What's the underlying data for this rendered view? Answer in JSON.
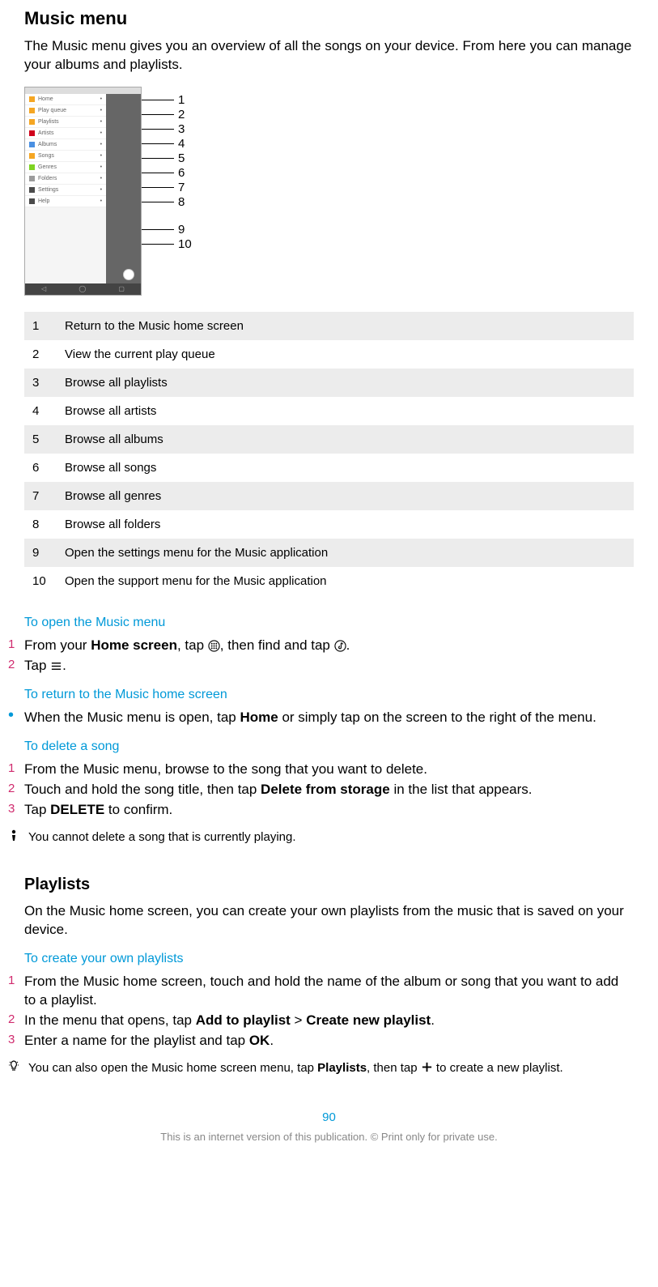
{
  "h1": "Music menu",
  "intro": "The Music menu gives you an overview of all the songs on your device. From here you can manage your albums and playlists.",
  "phone_menu": [
    {
      "label": "Home",
      "color": "#f5a623"
    },
    {
      "label": "Play queue",
      "color": "#f5a623"
    },
    {
      "label": "Playlists",
      "color": "#f5a623"
    },
    {
      "label": "Artists",
      "color": "#d0021b"
    },
    {
      "label": "Albums",
      "color": "#4a90e2"
    },
    {
      "label": "Songs",
      "color": "#f5a623"
    },
    {
      "label": "Genres",
      "color": "#7ed321"
    },
    {
      "label": "Folders",
      "color": "#9b9b9b"
    },
    {
      "label": "Settings",
      "color": "#4a4a4a"
    },
    {
      "label": "Help",
      "color": "#4a4a4a"
    }
  ],
  "callouts": [
    "1",
    "2",
    "3",
    "4",
    "5",
    "6",
    "7",
    "8",
    "9",
    "10"
  ],
  "legend": [
    {
      "n": "1",
      "t": "Return to the Music home screen"
    },
    {
      "n": "2",
      "t": "View the current play queue"
    },
    {
      "n": "3",
      "t": "Browse all playlists"
    },
    {
      "n": "4",
      "t": "Browse all artists"
    },
    {
      "n": "5",
      "t": "Browse all albums"
    },
    {
      "n": "6",
      "t": "Browse all songs"
    },
    {
      "n": "7",
      "t": "Browse all genres"
    },
    {
      "n": "8",
      "t": "Browse all folders"
    },
    {
      "n": "9",
      "t": "Open the settings menu for the Music application"
    },
    {
      "n": "10",
      "t": "Open the support menu for the Music application"
    }
  ],
  "proc_open": {
    "title": "To open the Music menu",
    "s1a": "From your ",
    "s1b": "Home screen",
    "s1c": ", tap ",
    "s1d": ", then find and tap ",
    "s1e": ".",
    "s2a": "Tap ",
    "s2b": "."
  },
  "proc_return": {
    "title": "To return to the Music home screen",
    "s1a": "When the Music menu is open, tap ",
    "s1b": "Home",
    "s1c": " or simply tap on the screen to the right of the menu."
  },
  "proc_delete": {
    "title": "To delete a song",
    "s1": "From the Music menu, browse to the song that you want to delete.",
    "s2a": "Touch and hold the song title, then tap ",
    "s2b": "Delete from storage",
    "s2c": " in the list that appears.",
    "s3a": "Tap ",
    "s3b": "DELETE",
    "s3c": " to confirm.",
    "note": "You cannot delete a song that is currently playing."
  },
  "playlists": {
    "title": "Playlists",
    "intro": "On the Music home screen, you can create your own playlists from the music that is saved on your device."
  },
  "proc_create": {
    "title": "To create your own playlists",
    "s1": "From the Music home screen, touch and hold the name of the album or song that you want to add to a playlist.",
    "s2a": "In the menu that opens, tap ",
    "s2b": "Add to playlist",
    "s2c": " > ",
    "s2d": "Create new playlist",
    "s2e": ".",
    "s3a": "Enter a name for the playlist and tap ",
    "s3b": "OK",
    "s3c": ".",
    "tip_a": "You can also open the Music home screen menu, tap ",
    "tip_b": "Playlists",
    "tip_c": ", then tap ",
    "tip_d": " to create a new playlist."
  },
  "page_number": "90",
  "footer": "This is an internet version of this publication. © Print only for private use."
}
